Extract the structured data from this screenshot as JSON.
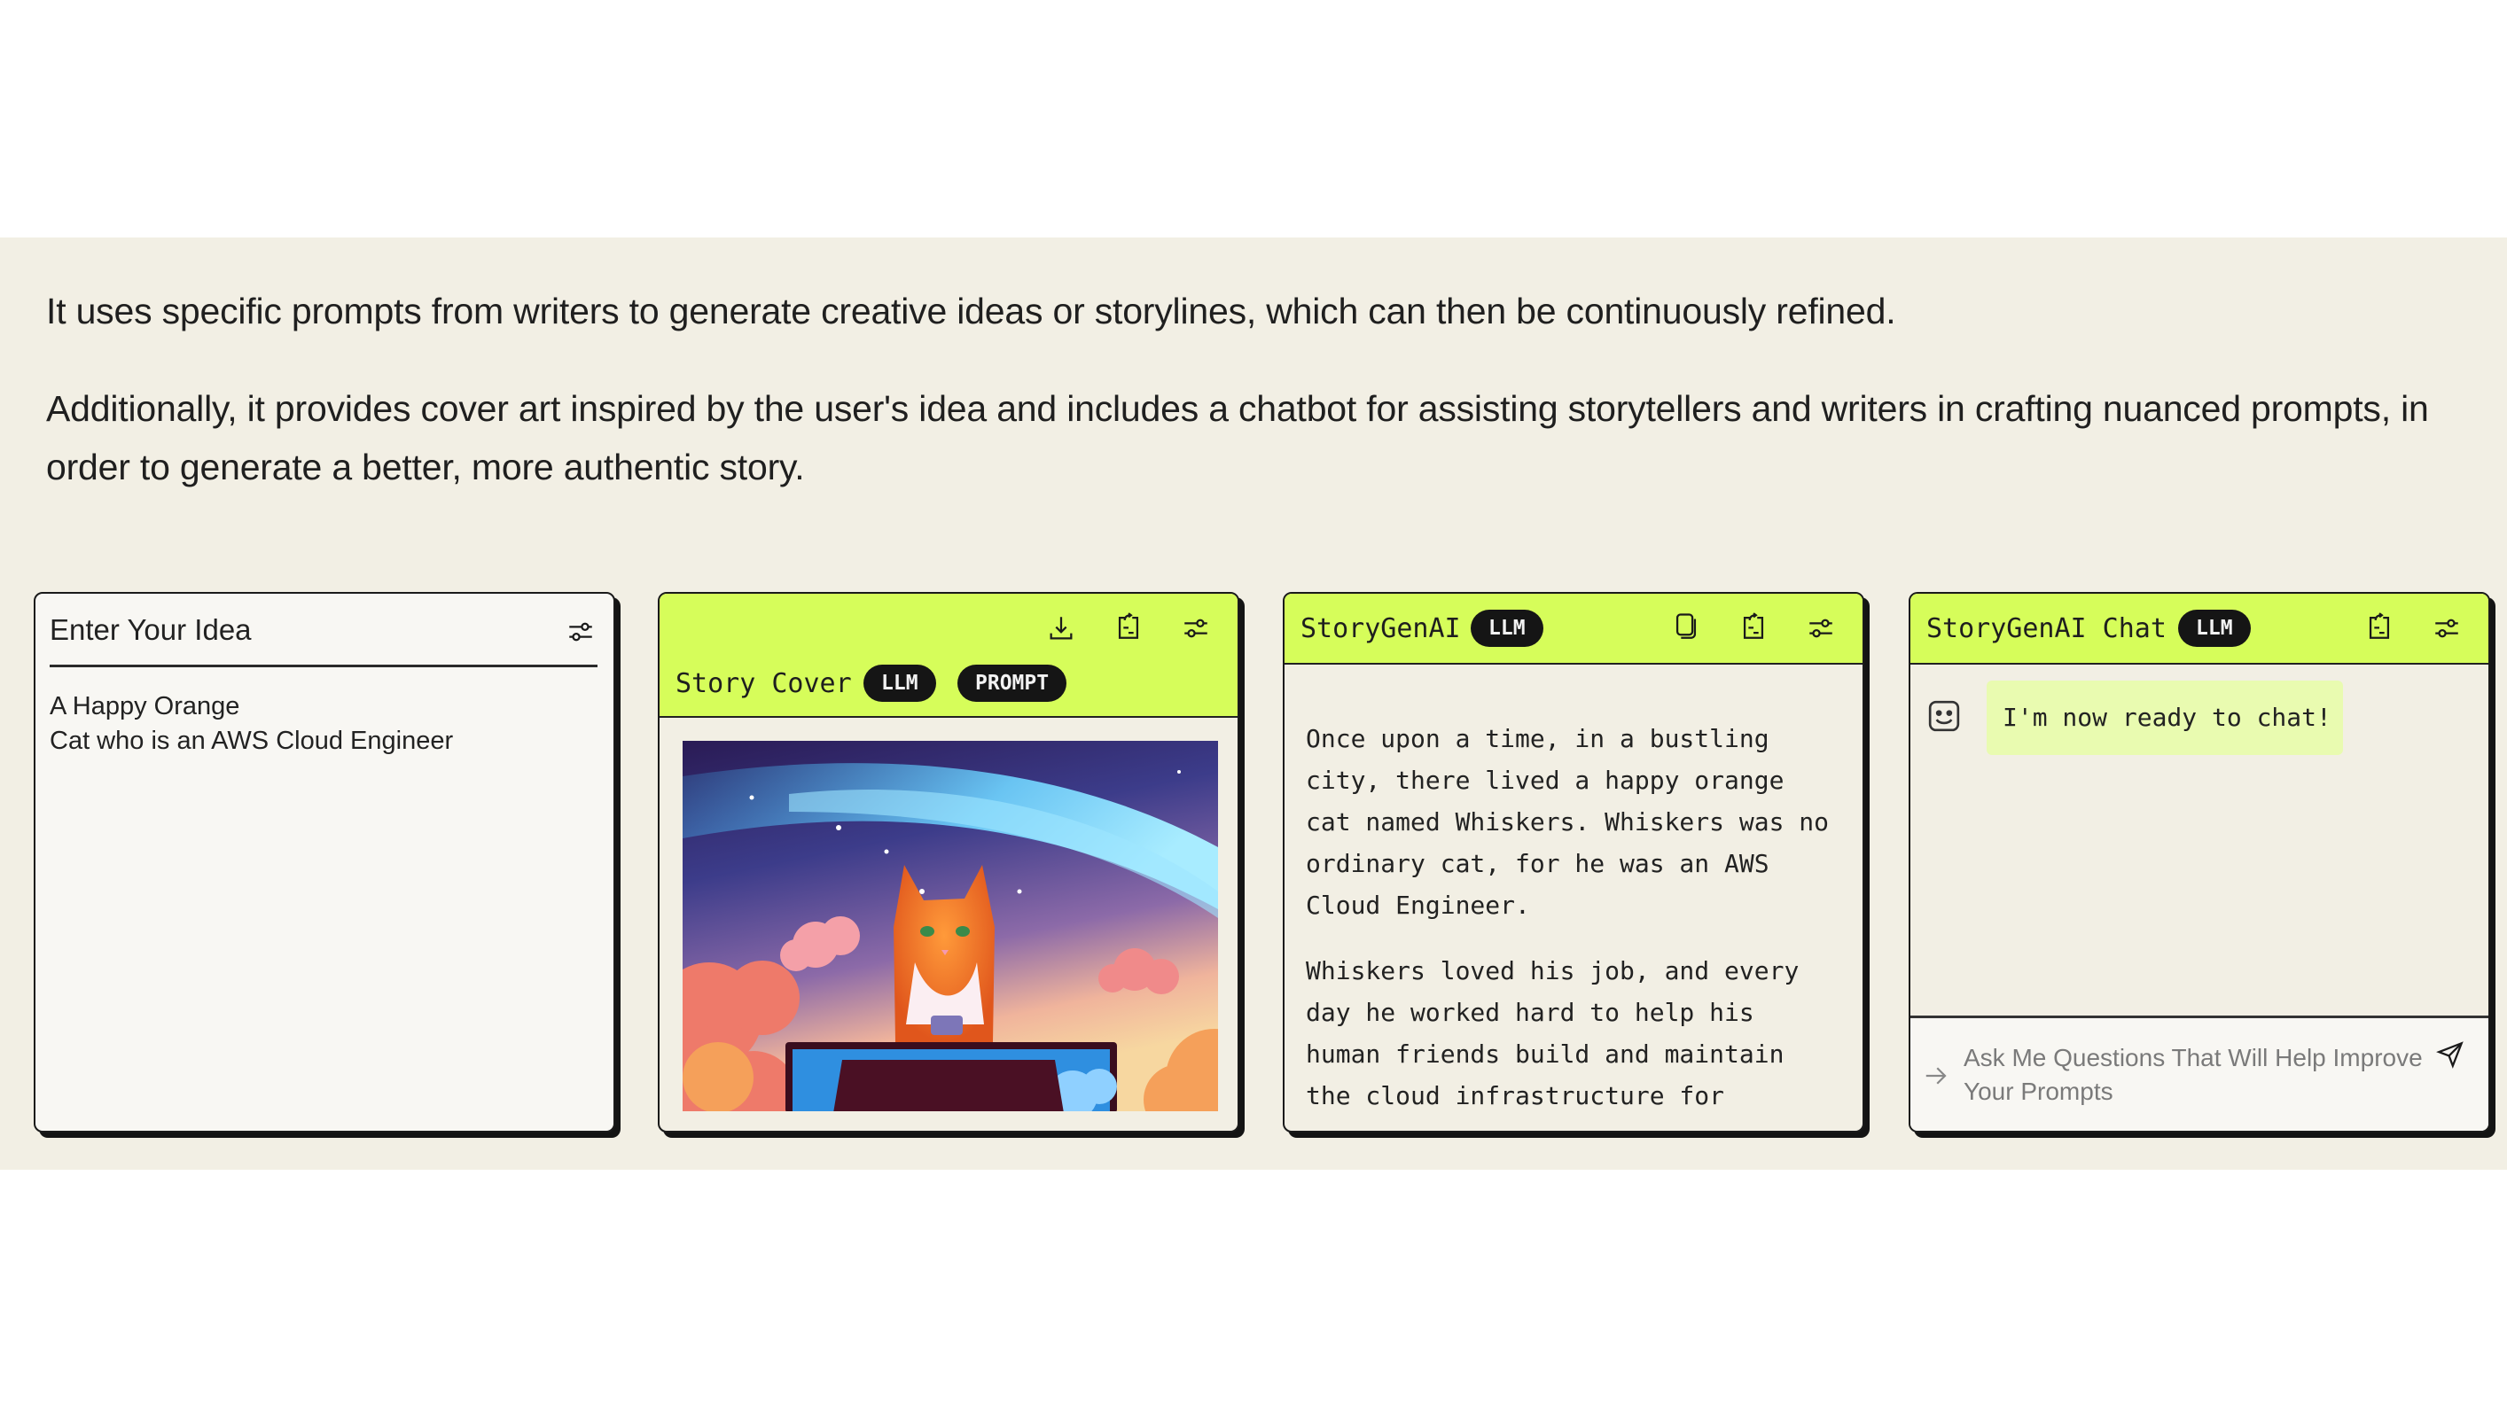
{
  "description": {
    "paragraph_1": "It uses specific prompts from writers to generate creative ideas or storylines, which can then be continuously refined.",
    "paragraph_2": "Additionally, it provides cover art inspired by the user's idea and includes a chatbot for assisting storytellers and writers in crafting nuanced prompts, in order to generate a better, more authentic story."
  },
  "colors": {
    "accent": "#d6fd5a",
    "band_background": "#f2efe4",
    "badge": "#151515",
    "chat_bubble": "#e9fbb0"
  },
  "idea_card": {
    "title": "Enter Your Idea",
    "icon": "sliders-icon",
    "idea_text": "A Happy Orange\nCat who is an AWS Cloud Engineer"
  },
  "cover_card": {
    "title": "Story Cover",
    "badges": [
      "LLM",
      "PROMPT"
    ],
    "icons": [
      "download-icon",
      "share-icon",
      "sliders-icon"
    ],
    "image_alt": "Orange cat sitting at a laptop under a starry sky with pink clouds"
  },
  "story_card": {
    "title": "StoryGenAI",
    "badge": "LLM",
    "icons": [
      "copy-icon",
      "share-icon",
      "sliders-icon"
    ],
    "paragraphs": [
      "Once upon a time, in a bustling city, there lived a happy orange cat named Whiskers. Whiskers was no ordinary cat, for he was an AWS Cloud Engineer.",
      "Whiskers loved his job, and every day he worked hard to help his human friends build and maintain the cloud infrastructure for"
    ]
  },
  "chat_card": {
    "title": "StoryGenAI Chat",
    "badge": "LLM",
    "icons": [
      "share-icon",
      "sliders-icon"
    ],
    "messages": [
      {
        "sender": "bot",
        "avatar": "smiley-icon",
        "text": "I'm now ready to chat!"
      }
    ],
    "input_placeholder": "Ask Me Questions That Will Help Improve Your Prompts",
    "send_icon": "send-icon"
  }
}
